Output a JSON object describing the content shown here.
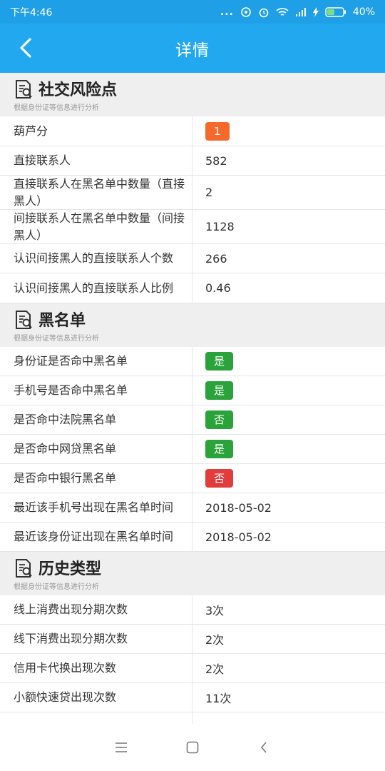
{
  "status_bar": {
    "time": "下午4:46",
    "battery": "40%",
    "dots": "..."
  },
  "app_bar": {
    "title": "详情"
  },
  "sections": [
    {
      "title": "社交风险点",
      "subtitle": "根据身份证等信息进行分析",
      "rows": [
        {
          "label": "葫芦分",
          "value": "1",
          "badge": "#f56a2c",
          "h": 42
        },
        {
          "label": "直接联系人",
          "value": "582",
          "h": 41
        },
        {
          "label": "直接联系人在黑名单中数量（直接黑人）",
          "value": "2",
          "h": 48
        },
        {
          "label": "间接联系人在黑名单中数量（间接黑人）",
          "value": "1128",
          "h": 48
        },
        {
          "label": "认识间接黑人的直接联系人个数",
          "value": "266",
          "h": 41
        },
        {
          "label": "认识间接黑人的直接联系人比例",
          "value": "0.46",
          "h": 42
        }
      ]
    },
    {
      "title": "黑名单",
      "subtitle": "根据身份证等信息进行分析",
      "rows": [
        {
          "label": "身份证是否命中黑名单",
          "value": "是",
          "badge": "#2aa33a",
          "h": 41
        },
        {
          "label": "手机号是否命中黑名单",
          "value": "是",
          "badge": "#2aa33a",
          "h": 41
        },
        {
          "label": "是否命中法院黑名单",
          "value": "否",
          "badge": "#2aa33a",
          "h": 41
        },
        {
          "label": "是否命中网贷黑名单",
          "value": "是",
          "badge": "#2aa33a",
          "h": 41
        },
        {
          "label": "是否命中银行黑名单",
          "value": "否",
          "badge": "#e23d3d",
          "h": 41
        },
        {
          "label": "最近该手机号出现在黑名单时间",
          "value": "2018-05-02",
          "h": 41
        },
        {
          "label": "最近该身份证出现在黑名单时间",
          "value": "2018-05-02",
          "h": 41
        }
      ]
    },
    {
      "title": "历史类型",
      "subtitle": "根据身份证等信息进行分析",
      "rows": [
        {
          "label": "线上消费出现分期次数",
          "value": "3次",
          "h": 41
        },
        {
          "label": "线下消费出现分期次数",
          "value": "2次",
          "h": 41
        },
        {
          "label": "信用卡代换出现次数",
          "value": "2次",
          "h": 41
        },
        {
          "label": "小额快速贷出现次数",
          "value": "11次",
          "h": 41
        },
        {
          "label": "",
          "value": "",
          "h": 41
        }
      ]
    }
  ],
  "icons": {
    "back": "chevron-left-icon",
    "section": "document-search-icon",
    "nav_menu": "menu-icon",
    "nav_home": "square-home-icon",
    "nav_back": "chevron-left-icon"
  }
}
